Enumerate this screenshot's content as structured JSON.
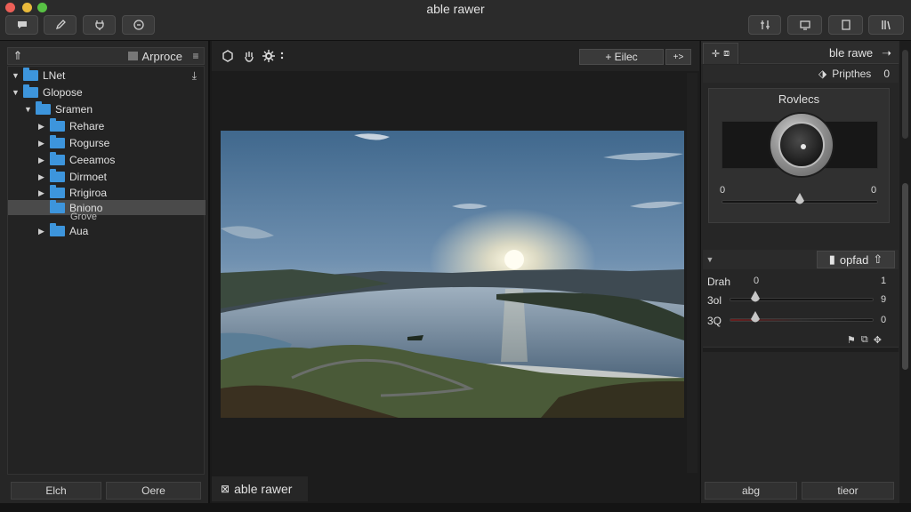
{
  "window": {
    "title": "able rawer"
  },
  "toolbar_left": [
    {
      "icon": "message-icon"
    },
    {
      "icon": "pen-icon"
    },
    {
      "icon": "plug-icon"
    },
    {
      "icon": "power-icon"
    }
  ],
  "toolbar_right": [
    {
      "icon": "adjust-icon"
    },
    {
      "icon": "monitor-icon"
    },
    {
      "icon": "square-icon"
    },
    {
      "icon": "library-icon"
    }
  ],
  "left_panel": {
    "header_label": "Arproce",
    "tree": [
      {
        "label": "LNet",
        "level": 0,
        "expanded": true,
        "download": true
      },
      {
        "label": "Glopose",
        "level": 0,
        "expanded": true
      },
      {
        "label": "Sramen",
        "level": 1,
        "expanded": true
      },
      {
        "label": "Rehare",
        "level": 2,
        "expanded": false
      },
      {
        "label": "Rogurse",
        "level": 2,
        "expanded": false
      },
      {
        "label": "Ceeamos",
        "level": 2,
        "expanded": false
      },
      {
        "label": "Dirmoet",
        "level": 2,
        "expanded": false
      },
      {
        "label": "Rrigiroa",
        "level": 2,
        "expanded": false
      },
      {
        "label": "Bniono",
        "level": 2,
        "selected": true,
        "sublabel": "Grove"
      },
      {
        "label": "Aua",
        "level": 2,
        "expanded": false
      }
    ],
    "footer_buttons": [
      "Elch",
      "Oere"
    ]
  },
  "center": {
    "toolbar_button_1": "+ Eilec",
    "toolbar_button_2": "+>",
    "status_label": "able rawer"
  },
  "right_panel": {
    "tab_label": "ble rawe",
    "sub_label": "Pripthes",
    "sub_value": "0",
    "preview_title": "Rovlecs",
    "preview_min": "0",
    "preview_max": "0",
    "preview_level": 0.5,
    "section_button": "opfad",
    "adjustments": [
      {
        "label": "Drah",
        "min": "0",
        "value": "1",
        "level": null
      },
      {
        "label": "3ol",
        "value": "9",
        "level": 0.18
      },
      {
        "label": "3Q",
        "value": "0",
        "level": 0.18
      }
    ],
    "footer_buttons": [
      "abg",
      "tieor"
    ]
  },
  "colors": {
    "accent_folder": "#3d95dc",
    "background": "#1a1a1a"
  }
}
